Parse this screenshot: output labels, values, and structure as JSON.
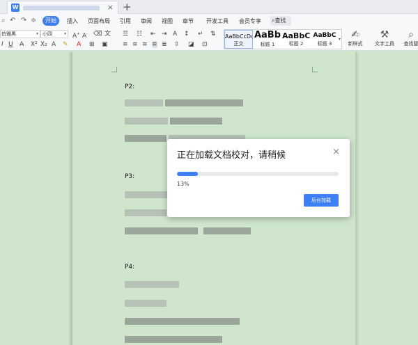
{
  "app": {
    "logo_letter": "W",
    "new_tab": "+",
    "close_tab": "×"
  },
  "quick_access": [
    "⌕",
    "↶",
    "↷",
    "≑"
  ],
  "menu": {
    "active": "开始",
    "items": [
      "插入",
      "页面布局",
      "引用",
      "审阅",
      "视图",
      "章节",
      "开发工具",
      "会员专享"
    ],
    "search_label": "查找"
  },
  "ribbon": {
    "font_name": "方正仿宋_GB2312 楷",
    "font_name_visible": "仿雅黑",
    "font_size": "小四",
    "styles": [
      {
        "sample": "AaBbCcDd",
        "name": "正文"
      },
      {
        "sample": "AaBb",
        "name": "标题 1"
      },
      {
        "sample": "AaBbC",
        "name": "标题 2"
      },
      {
        "sample": "AaBbC",
        "name": "标题 3"
      }
    ],
    "new_style": "新样式",
    "text_tool": "文字工具",
    "find_replace": "查找替"
  },
  "document": {
    "headings": [
      "P2:",
      "P3:",
      "P4:"
    ]
  },
  "dialog": {
    "title": "正在加载文档校对，请稍候",
    "progress_text": "13%",
    "progress": 0.13,
    "button": "后台加载",
    "close": "×"
  },
  "colors": {
    "accent": "#3d7ff6",
    "page_bg": "#cfe6cd"
  }
}
